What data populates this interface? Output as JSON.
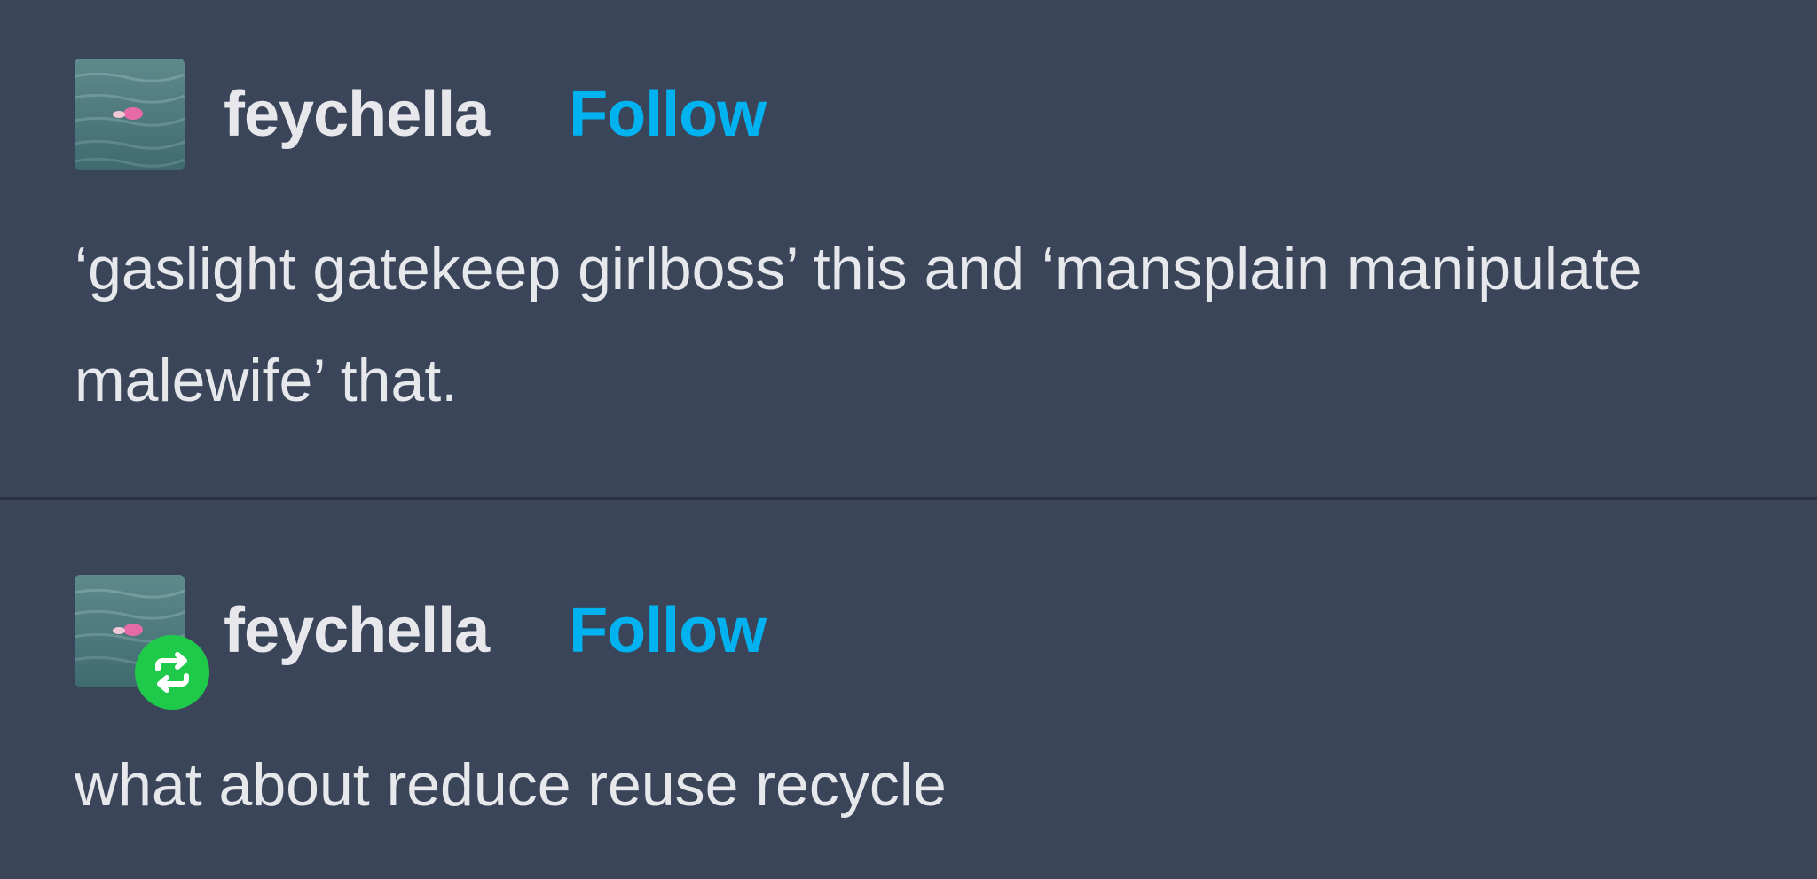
{
  "posts": [
    {
      "username": "feychella",
      "follow_label": "Follow",
      "is_reblog": false,
      "text": "‘gaslight gatekeep girlboss’ this and ‘mansplain manipulate malewife’ that."
    },
    {
      "username": "feychella",
      "follow_label": "Follow",
      "is_reblog": true,
      "reblog_icon": "reblog-icon",
      "text": "what about reduce reuse recycle"
    }
  ],
  "colors": {
    "background": "#3b4559",
    "follow": "#00b3f0",
    "reblog_badge": "#1fc94a",
    "divider": "#2b3342"
  }
}
